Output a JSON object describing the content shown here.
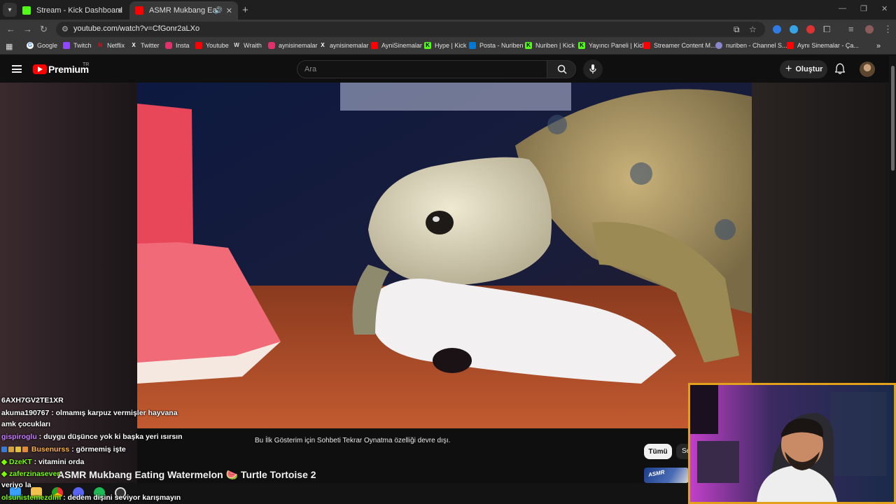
{
  "browser": {
    "tabs": [
      {
        "title": "Stream - Kick Dashboard",
        "active": false,
        "favicon_color": "#53fc18"
      },
      {
        "title": "ASMR Mukbang Eating Wa",
        "active": true,
        "favicon_color": "#ff0000"
      }
    ],
    "new_tab_label": "+",
    "url": "youtube.com/watch?v=CfGonr2aLXo",
    "bookmarks": [
      {
        "label": "Google",
        "icon": "google-icon",
        "color": "#4285f4"
      },
      {
        "label": "Twitch",
        "icon": "twitch-icon",
        "color": "#9146ff"
      },
      {
        "label": "Netflix",
        "icon": "netflix-icon",
        "color": "#e50914"
      },
      {
        "label": "Twitter",
        "icon": "x-icon",
        "color": "#ffffff"
      },
      {
        "label": "Insta",
        "icon": "instagram-icon",
        "color": "#e1306c"
      },
      {
        "label": "Youtube",
        "icon": "youtube-icon",
        "color": "#ff0000"
      },
      {
        "label": "Wraith",
        "icon": "wraith-icon",
        "color": "#dddddd"
      },
      {
        "label": "aynisinemalar",
        "icon": "instagram-icon",
        "color": "#e1306c"
      },
      {
        "label": "aynisinemalar",
        "icon": "x-icon",
        "color": "#ffffff"
      },
      {
        "label": "AyniSinemalar",
        "icon": "youtube-icon",
        "color": "#ff0000"
      },
      {
        "label": "Hype | Kick",
        "icon": "kick-icon",
        "color": "#53fc18"
      },
      {
        "label": "Posta - Nuriben",
        "icon": "outlook-icon",
        "color": "#0078d4"
      },
      {
        "label": "Nuriben | Kick",
        "icon": "kick-icon",
        "color": "#53fc18"
      },
      {
        "label": "Yayıncı Paneli | Kick",
        "icon": "kick-icon",
        "color": "#53fc18"
      },
      {
        "label": "Streamer Content M...",
        "icon": "youtube-icon",
        "color": "#ff0000"
      },
      {
        "label": "nuriben - Channel S...",
        "icon": "channel-icon",
        "color": "#aaaaff"
      },
      {
        "label": "Aynı Sinemalar - Ça...",
        "icon": "youtube-icon",
        "color": "#ff0000"
      }
    ],
    "bookmarks_overflow": "»"
  },
  "youtube": {
    "logo_text": "Premium",
    "country_code": "TR",
    "search_placeholder": "Ara",
    "create_label": "Oluştur",
    "video_title": "ASMR Mukbang Eating Watermelon 🍉 Turtle Tortoise 2",
    "chat_replay_message": "Bu İlk Gösterim için Sohbeti Tekrar Oynatma özelliği devre dışı.",
    "chips": [
      "Tümü",
      "Se"
    ],
    "thumbnail_text": "ASMR"
  },
  "stream_chat": [
    {
      "user": "6AXH7GV2TE1XR",
      "message": "",
      "color": "#ffffff"
    },
    {
      "user": "akuma190767",
      "message": " : olmamış karpuz vermişler hayvana",
      "color": "#ffffff"
    },
    {
      "user": "",
      "message": "amk çocukları",
      "color": "#ffffff"
    },
    {
      "user": "gispiroglu",
      "message": " : duygu düşünce yok ki başka yeri ısırsın",
      "color": "#c77dff"
    },
    {
      "user": "Busenurss",
      "message": " : görmemiş işte",
      "color": "#ffb347"
    },
    {
      "user": "DzeKT",
      "message": " : vitamini orda",
      "color": "#7cfc00"
    },
    {
      "user": "zaferzinasever",
      "message": "",
      "color": "#7cfc00"
    },
    {
      "user": "",
      "message": "veriyo la",
      "color": "#ffffff"
    },
    {
      "user": "olsunistemezdim",
      "message": " : dedem dişini seviyor karışmayın",
      "color": "#7cfc00"
    }
  ]
}
